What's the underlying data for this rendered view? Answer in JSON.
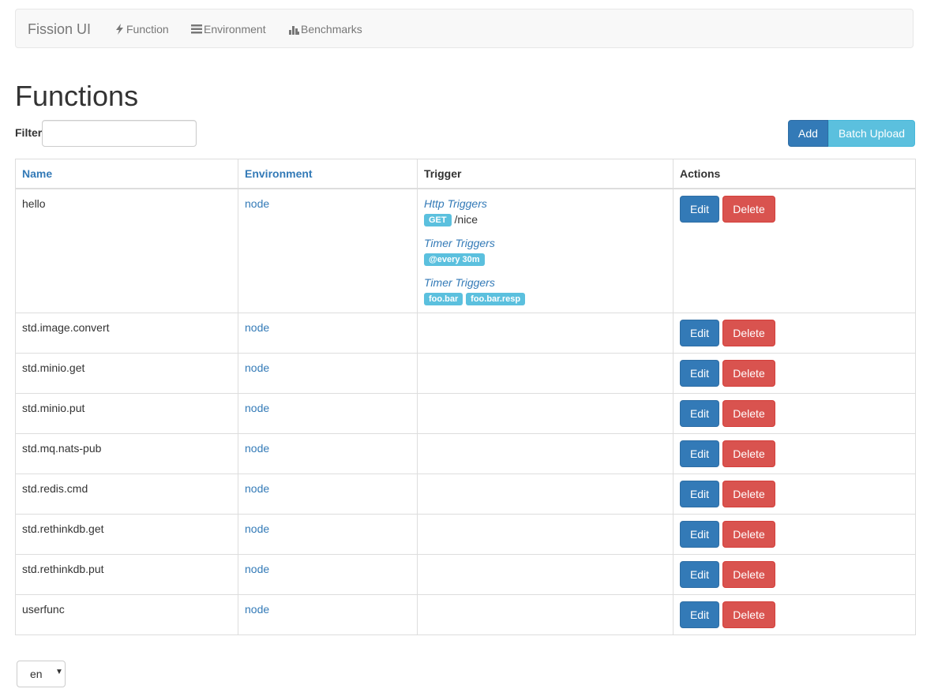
{
  "nav": {
    "brand": "Fission UI",
    "links": [
      {
        "label": "Function",
        "icon": "flash-icon"
      },
      {
        "label": "Environment",
        "icon": "list-icon"
      },
      {
        "label": "Benchmarks",
        "icon": "bar-chart-icon"
      }
    ]
  },
  "page": {
    "title": "Functions",
    "filter_label": "Filter",
    "filter_value": "",
    "add_label": "Add",
    "batch_label": "Batch Upload"
  },
  "table": {
    "headers": [
      "Name",
      "Environment",
      "Trigger",
      "Actions"
    ],
    "edit_label": "Edit",
    "delete_label": "Delete",
    "rows": [
      {
        "name": "hello",
        "env": "node",
        "http_title": "Http Triggers",
        "http_method": "GET",
        "http_path": "/nice",
        "timer_title": "Timer Triggers",
        "timer_cron": "@every 30m",
        "mq_title": "Timer Triggers",
        "mq_topic": "foo.bar",
        "mq_resp": "foo.bar.resp"
      },
      {
        "name": "std.image.convert",
        "env": "node"
      },
      {
        "name": "std.minio.get",
        "env": "node"
      },
      {
        "name": "std.minio.put",
        "env": "node"
      },
      {
        "name": "std.mq.nats-pub",
        "env": "node"
      },
      {
        "name": "std.redis.cmd",
        "env": "node"
      },
      {
        "name": "std.rethinkdb.get",
        "env": "node"
      },
      {
        "name": "std.rethinkdb.put",
        "env": "node"
      },
      {
        "name": "userfunc",
        "env": "node"
      }
    ]
  },
  "language": {
    "selected": "en"
  },
  "colors": {
    "primary": "#337ab7",
    "info": "#5bc0de",
    "danger": "#d9534f"
  }
}
